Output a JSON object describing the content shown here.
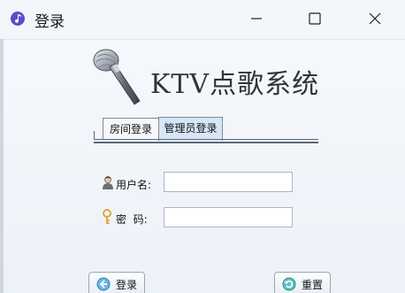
{
  "window": {
    "title": "登录"
  },
  "app": {
    "name": "KTV点歌系统"
  },
  "tabs": [
    {
      "label": "房间登录"
    },
    {
      "label": "管理员登录",
      "selected": true
    }
  ],
  "form": {
    "username_label": "用户名:",
    "password_label": "密  码:",
    "username_value": "",
    "password_value": ""
  },
  "buttons": {
    "login": "登录",
    "reset": "重置"
  },
  "colors": {
    "accent": "#d7e6f7",
    "titlebar": "#f3f6fb"
  }
}
